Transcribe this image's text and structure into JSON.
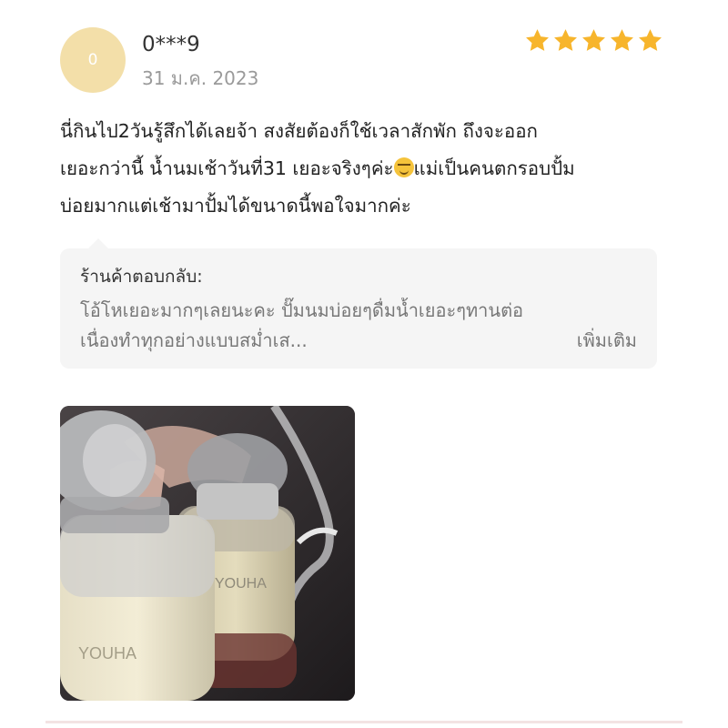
{
  "review": {
    "avatar_initial": "0",
    "avatar_color": "#f3dfa9",
    "username": "0***9",
    "date": "31 ม.ค. 2023",
    "rating": 5,
    "star_color": "#f7b52c",
    "text_lines": [
      "นี่กินไป2วันรู้สึกได้เลยจ้า  สงสัยต้องก็ใช้เวลาสักพัก ถึงจะออก",
      "เยอะกว่านี้  น้ำนมเช้าวันที่31 เยอะจริงๆค่ะ",
      "แม่เป็นคนตกรอบปั้ม",
      "บ่อยมากแต่เช้ามาปั้มได้ขนาดนี้พอใจมากค่ะ"
    ],
    "emoji": "smiling-face-emoji"
  },
  "seller_reply": {
    "title": "ร้านค้าตอบกลับ:",
    "lines": [
      "โอ้โหเยอะมากๆเลยนะคะ ปั๊มนมบ่อยๆดื่มน้ำเยอะๆทานต่อ",
      "เนื่องทำทุกอย่างแบบสม่ำเส..."
    ],
    "more_label": "เพิ่มเติม"
  },
  "photo": {
    "bottle_labels": [
      "YOUHA",
      "YOUHA"
    ]
  }
}
